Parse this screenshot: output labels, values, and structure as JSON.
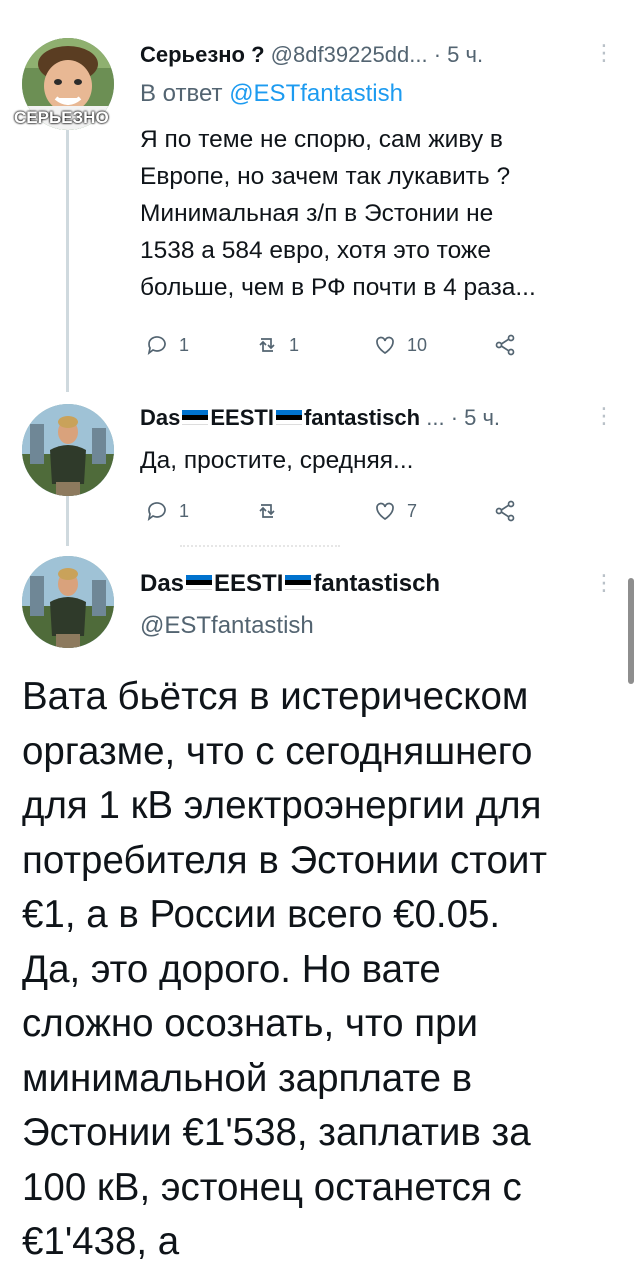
{
  "reply1": {
    "name": "Серьезно ?",
    "handle": "@8df39225dd...",
    "time": "· 5 ч.",
    "avatar_caption": "СЕРЬЕЗНО",
    "reply_prefix": "В ответ",
    "reply_handle": "@ESTfantastish",
    "text_lines": [
      "Я по теме не спорю, сам живу в",
      "Европе, но зачем так лукавить ?",
      "Минимальная з/п в Эстонии не",
      "1538 а 584 евро, хотя это тоже",
      "больше, чем в РФ почти в 4 раза..."
    ],
    "reply_count": "1",
    "retweet_count": "1",
    "like_count": "10"
  },
  "reply2": {
    "name_part1": "Das",
    "name_part2": "EESTI",
    "name_part3": "fantastisch",
    "handle": "...",
    "time": "· 5 ч.",
    "text": "Да, простите, средняя...",
    "reply_count": "1",
    "retweet_count": "",
    "like_count": "7"
  },
  "main": {
    "name_part1": "Das",
    "name_part2": "EESTI",
    "name_part3": "fantastisch",
    "handle": "@ESTfantastish",
    "text_lines": [
      "Вата бьётся в истерическом",
      "оргазме, что с сегодняшнего",
      "для 1 кВ электроэнергии для",
      "потребителя в Эстонии стоит",
      "€1, а в России всего €0.05.",
      "Да, это дорого. Но вате",
      "сложно осознать, что при",
      "минимальной зарплате в",
      "Эстонии €1'538, заплатив за",
      "100 кВ, эстонец останется с",
      "€1'438, а"
    ]
  },
  "colors": {
    "flag_blue": "#0072ce",
    "flag_black": "#000000",
    "flag_white": "#ffffff",
    "link": "#1d9bf0",
    "secondary_text": "#536471"
  }
}
